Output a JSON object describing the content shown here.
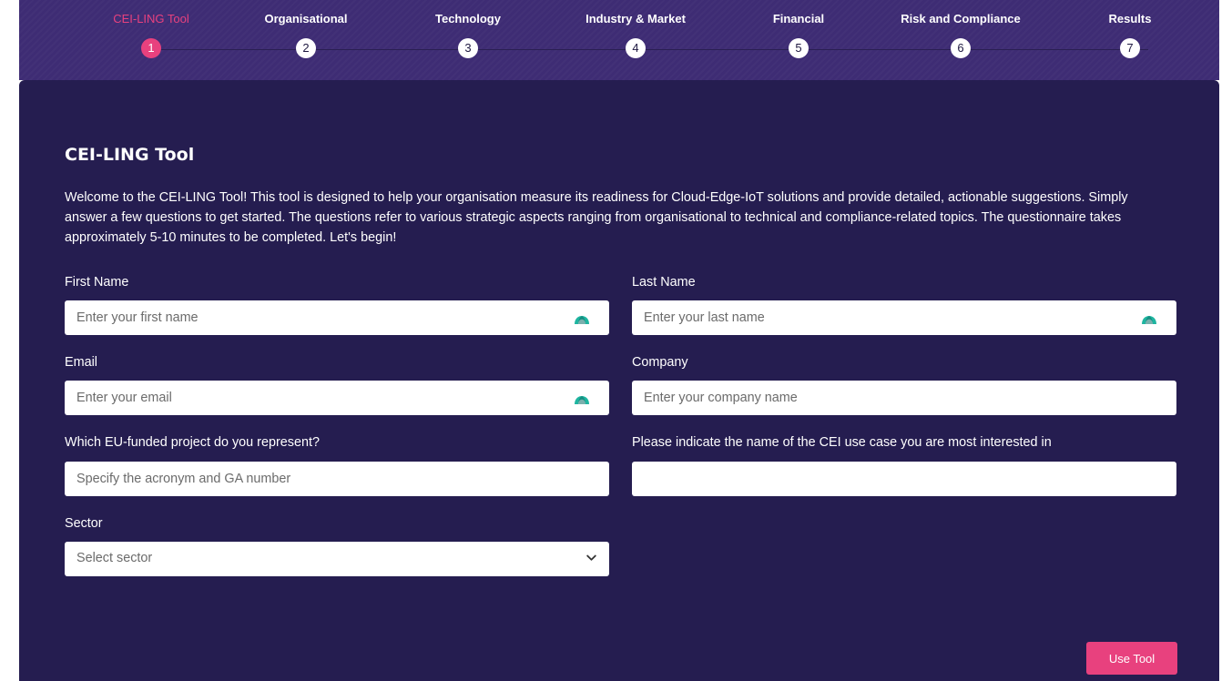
{
  "steps": [
    {
      "label": "CEI-LING Tool",
      "number": "1",
      "active": true
    },
    {
      "label": "Organisational",
      "number": "2",
      "active": false
    },
    {
      "label": "Technology",
      "number": "3",
      "active": false
    },
    {
      "label": "Industry & Market",
      "number": "4",
      "active": false
    },
    {
      "label": "Financial",
      "number": "5",
      "active": false
    },
    {
      "label": "Risk and Compliance",
      "number": "6",
      "active": false
    },
    {
      "label": "Results",
      "number": "7",
      "active": false
    }
  ],
  "form": {
    "title": "CEI-LING Tool",
    "intro": "Welcome to the CEI-LING Tool! This tool is designed to help your organisation measure its readiness for Cloud-Edge-IoT solutions and provide detailed, actionable suggestions. Simply answer a few questions to get started. The questions refer to various strategic aspects ranging from organisational to technical and compliance-related topics. The questionnaire takes approximately 5-10 minutes to be completed. Let's begin!",
    "first_name": {
      "label": "First Name",
      "placeholder": "Enter your first name",
      "value": ""
    },
    "last_name": {
      "label": "Last Name",
      "placeholder": "Enter your last name",
      "value": ""
    },
    "email": {
      "label": "Email",
      "placeholder": "Enter your email",
      "value": ""
    },
    "company": {
      "label": "Company",
      "placeholder": "Enter your company name",
      "value": ""
    },
    "project": {
      "label": "Which EU-funded project do you represent?",
      "placeholder": "Specify the acronym and GA number",
      "value": ""
    },
    "use_case": {
      "label": "Please indicate the name of the CEI use case you are most interested in",
      "placeholder": "",
      "value": ""
    },
    "sector": {
      "label": "Sector",
      "selected": "Select sector"
    },
    "submit_label": "Use Tool"
  },
  "icons": {
    "autofill": "password-manager-autofill-icon",
    "dropdown": "chevron-down-icon"
  },
  "colors": {
    "accent": "#e8417e",
    "panel": "#251d50",
    "stepper": "#3e2c74",
    "autofill_icon": "#1fb5a0"
  }
}
